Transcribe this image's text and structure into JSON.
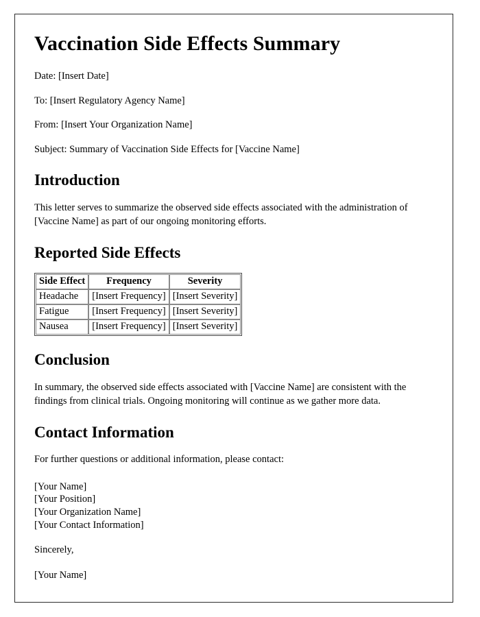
{
  "document": {
    "title": "Vaccination Side Effects Summary",
    "header_fields": [
      {
        "label": "Date:",
        "value": "[Insert Date]",
        "text": "Date: [Insert Date]"
      },
      {
        "label": "To:",
        "value": "[Insert Regulatory Agency Name]",
        "text": "To: [Insert Regulatory Agency Name]"
      },
      {
        "label": "From:",
        "value": "[Insert Your Organization Name]",
        "text": "From: [Insert Your Organization Name]"
      },
      {
        "label": "Subject:",
        "value": "Summary of Vaccination Side Effects for [Vaccine Name]",
        "text": "Subject: Summary of Vaccination Side Effects for [Vaccine Name]"
      }
    ],
    "sections": {
      "introduction": {
        "heading": "Introduction",
        "paragraph": "This letter serves to summarize the observed side effects associated with the administration of [Vaccine Name] as part of our ongoing monitoring efforts."
      },
      "reported_side_effects": {
        "heading": "Reported Side Effects",
        "table": {
          "columns": [
            "Side Effect",
            "Frequency",
            "Severity"
          ],
          "rows": [
            [
              "Headache",
              "[Insert Frequency]",
              "[Insert Severity]"
            ],
            [
              "Fatigue",
              "[Insert Frequency]",
              "[Insert Severity]"
            ],
            [
              "Nausea",
              "[Insert Frequency]",
              "[Insert Severity]"
            ]
          ]
        }
      },
      "conclusion": {
        "heading": "Conclusion",
        "paragraph": "In summary, the observed side effects associated with [Vaccine Name] are consistent with the findings from clinical trials. Ongoing monitoring will continue as we gather more data."
      },
      "contact_information": {
        "heading": "Contact Information",
        "intro": "For further questions or additional information, please contact:",
        "signature_block": [
          "[Your Name]",
          "[Your Position]",
          "[Your Organization Name]",
          "[Your Contact Information]"
        ],
        "closing": "Sincerely,",
        "signature_name": "[Your Name]"
      }
    }
  },
  "style": {
    "text_color": "#000000",
    "page_background": "#ffffff",
    "page_border_color": "#2b2b2b",
    "table_border_color": "#4a4a4a",
    "table_cell_border_color": "#8a8a8a"
  }
}
